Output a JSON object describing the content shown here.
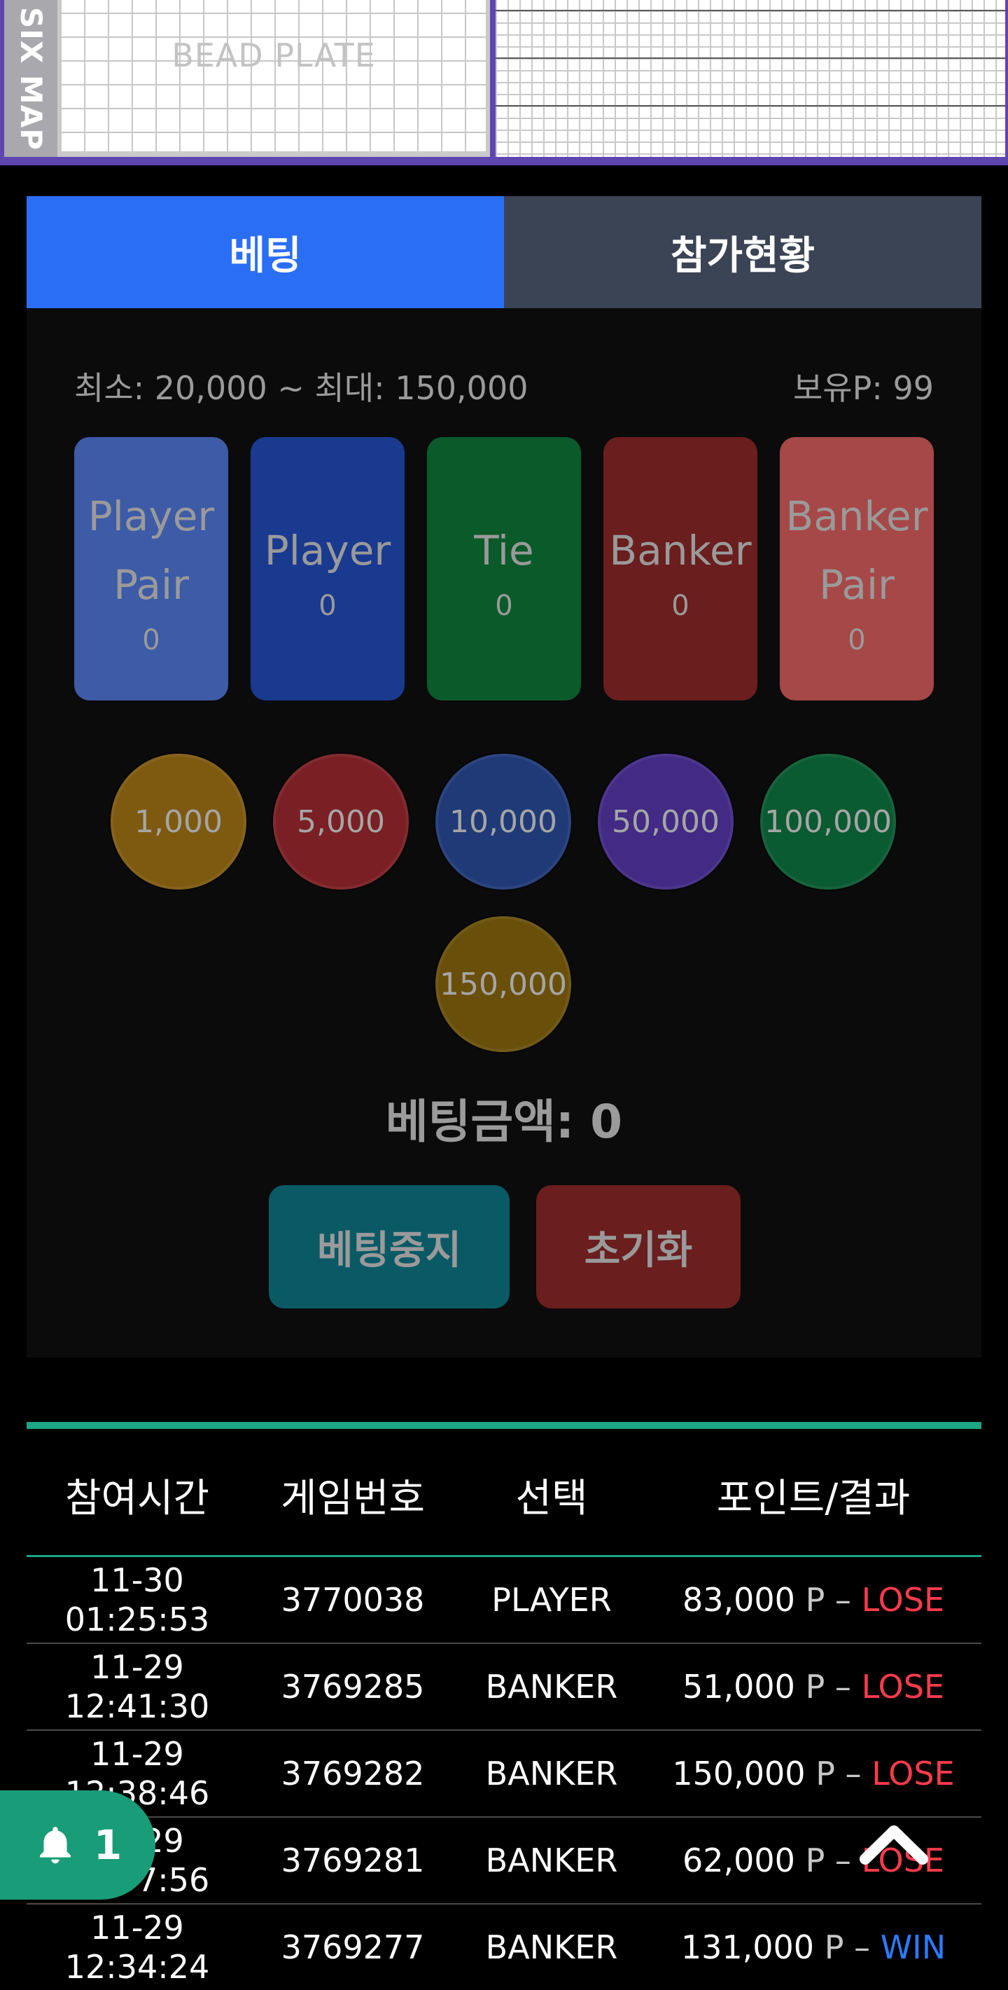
{
  "scoreboard": {
    "six_map_label": "SIX MAP",
    "bead_plate_label": "BEAD PLATE"
  },
  "tabs": [
    {
      "label": "베팅",
      "active": true
    },
    {
      "label": "참가현황",
      "active": false
    }
  ],
  "betting": {
    "limits": "최소: 20,000 ~ 최대: 150,000",
    "points": "보유P: 99",
    "boxes": [
      {
        "label_line1": "Player",
        "label_line2": "Pair",
        "amount": "0"
      },
      {
        "label_line1": "Player",
        "label_line2": "",
        "amount": "0"
      },
      {
        "label_line1": "Tie",
        "label_line2": "",
        "amount": "0"
      },
      {
        "label_line1": "Banker",
        "label_line2": "",
        "amount": "0"
      },
      {
        "label_line1": "Banker",
        "label_line2": "Pair",
        "amount": "0"
      }
    ],
    "chips": [
      "1,000",
      "5,000",
      "10,000",
      "50,000",
      "100,000",
      "150,000"
    ],
    "bet_amount": "베팅금액: 0",
    "stop_button": "베팅중지",
    "reset_button": "초기화"
  },
  "history": {
    "headers": [
      "참여시간",
      "게임번호",
      "선택",
      "포인트/결과"
    ],
    "rows": [
      {
        "date": "11-30",
        "time": "01:25:53",
        "game": "3770038",
        "selection": "PLAYER",
        "points": "83,000",
        "unit": "P –",
        "result": "LOSE"
      },
      {
        "date": "11-29",
        "time": "12:41:30",
        "game": "3769285",
        "selection": "BANKER",
        "points": "51,000",
        "unit": "P –",
        "result": "LOSE"
      },
      {
        "date": "11-29",
        "time": "12:38:46",
        "game": "3769282",
        "selection": "BANKER",
        "points": "150,000",
        "unit": "P –",
        "result": "LOSE"
      },
      {
        "date": "11-29",
        "time": "12:37:56",
        "game": "3769281",
        "selection": "BANKER",
        "points": "62,000",
        "unit": "P –",
        "result": "LOSE"
      },
      {
        "date": "11-29",
        "time": "12:34:24",
        "game": "3769277",
        "selection": "BANKER",
        "points": "131,000",
        "unit": "P –",
        "result": "WIN"
      }
    ]
  },
  "notification": {
    "count": "1",
    "icon": "bell-icon"
  },
  "scroll_top": {
    "icon": "chevron-up-icon"
  },
  "colors": {
    "tab_active": "#2b6ef6",
    "player": "#2b7bff",
    "banker": "#ff3b4c",
    "accent": "#1ea584"
  }
}
